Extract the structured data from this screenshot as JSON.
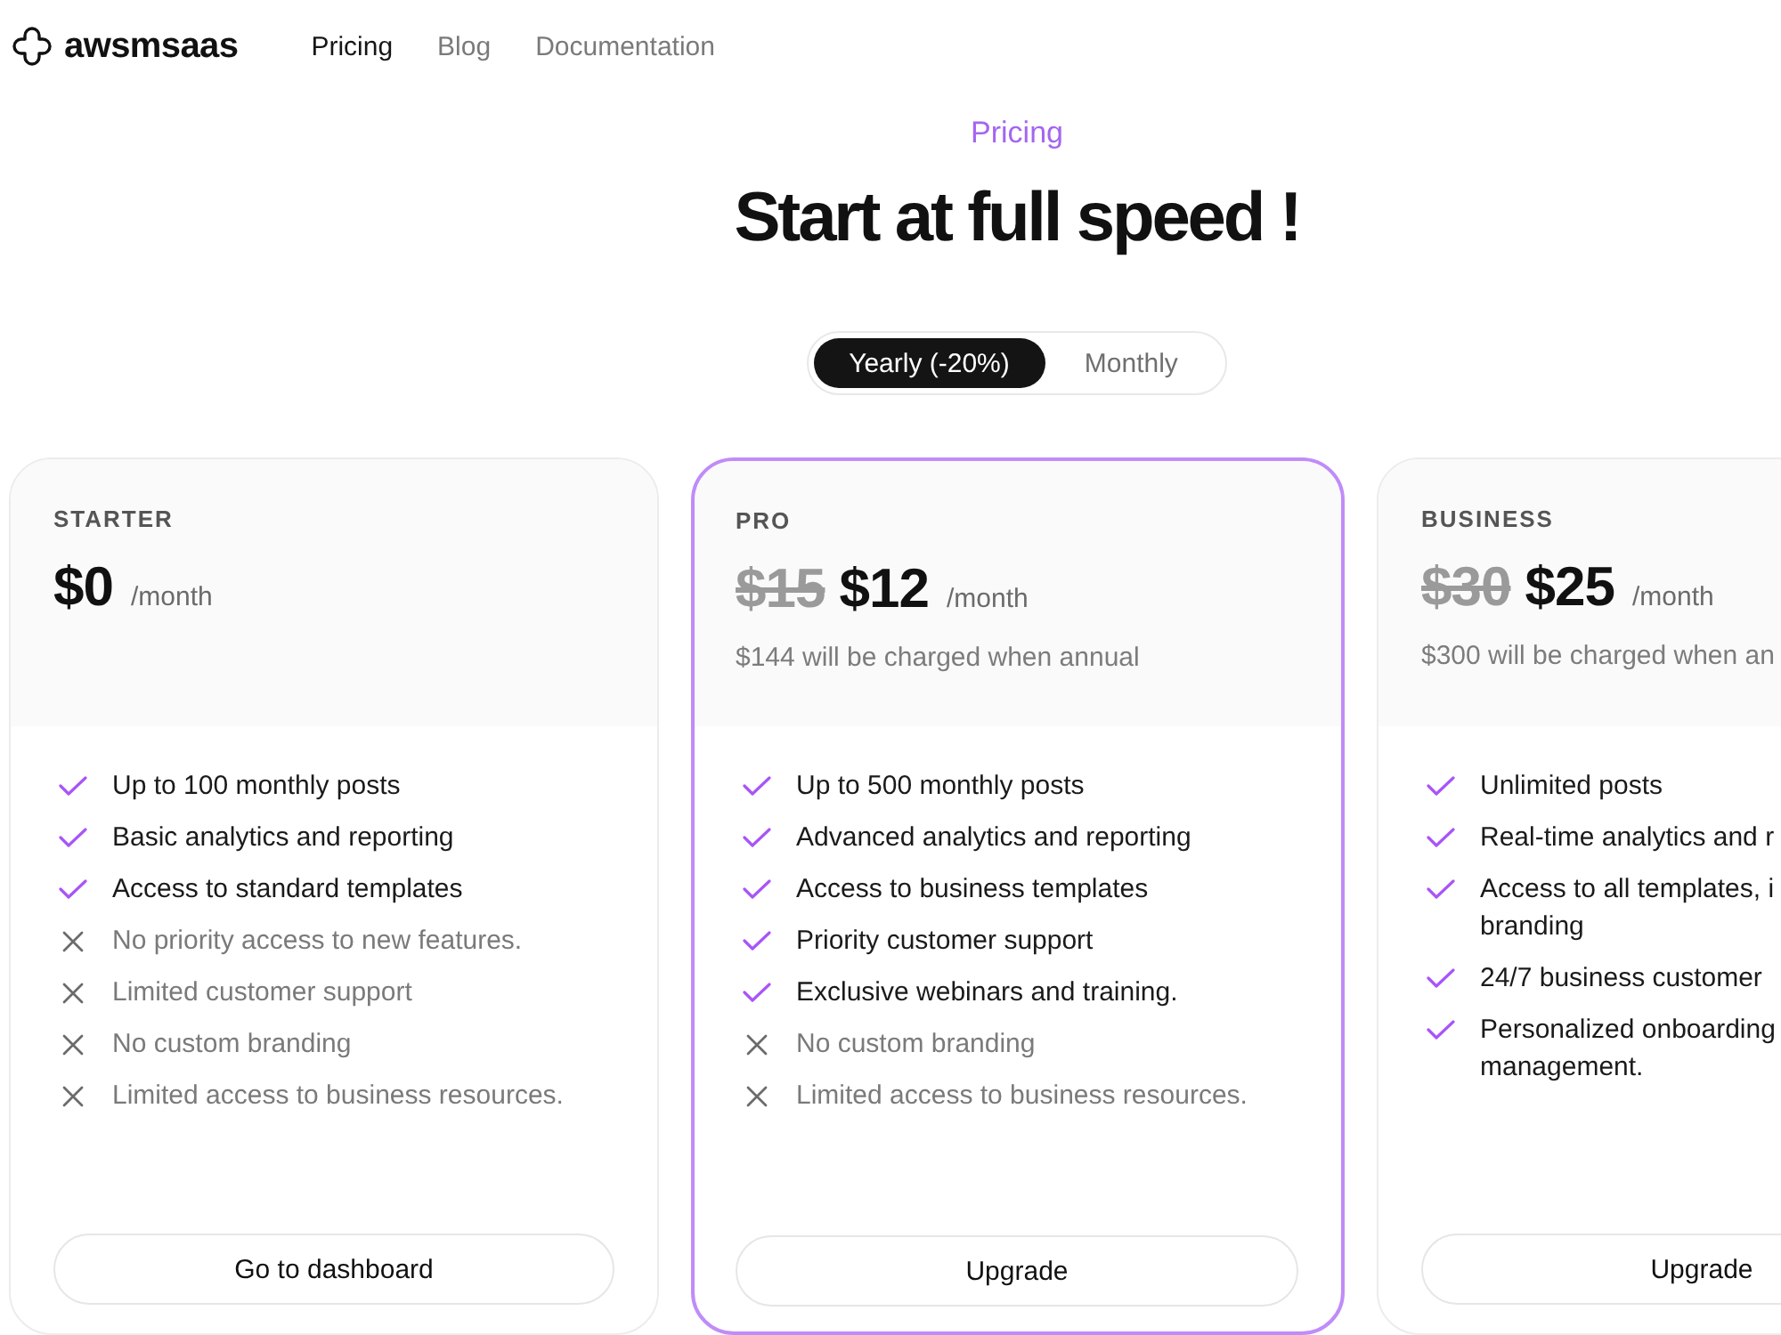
{
  "nav": {
    "logo": "awsmsaas",
    "links": [
      {
        "label": "Pricing",
        "selected": true
      },
      {
        "label": "Blog",
        "selected": false
      },
      {
        "label": "Documentation",
        "selected": false
      }
    ]
  },
  "hero": {
    "eyebrow": "Pricing",
    "title": "Start at full speed !"
  },
  "billing_toggle": [
    {
      "label": "Yearly (-20%)",
      "selected": true
    },
    {
      "label": "Monthly",
      "selected": false
    }
  ],
  "plans": [
    {
      "name": "STARTER",
      "highlighted": false,
      "price": "$0",
      "period": "/month",
      "features": [
        {
          "lines": [
            "Up to 100 monthly posts"
          ],
          "included": true
        },
        {
          "lines": [
            "Basic analytics and reporting"
          ],
          "included": true
        },
        {
          "lines": [
            "Access to standard templates"
          ],
          "included": true
        },
        {
          "lines": [
            "No priority access to new features."
          ],
          "included": false
        },
        {
          "lines": [
            "Limited customer support"
          ],
          "included": false
        },
        {
          "lines": [
            "No custom branding"
          ],
          "included": false
        },
        {
          "lines": [
            "Limited access to business resources."
          ],
          "included": false
        }
      ],
      "button": "Go to dashboard"
    },
    {
      "name": "PRO",
      "highlighted": true,
      "old_price": "$15",
      "price": "$12",
      "period": "/month",
      "note": "$144 will be charged when annual",
      "features": [
        {
          "lines": [
            "Up to 500 monthly posts"
          ],
          "included": true
        },
        {
          "lines": [
            "Advanced analytics and reporting"
          ],
          "included": true
        },
        {
          "lines": [
            "Access to business templates"
          ],
          "included": true
        },
        {
          "lines": [
            "Priority customer support"
          ],
          "included": true
        },
        {
          "lines": [
            "Exclusive webinars and training."
          ],
          "included": true
        },
        {
          "lines": [
            "No custom branding"
          ],
          "included": false
        },
        {
          "lines": [
            "Limited access to business resources."
          ],
          "included": false
        }
      ],
      "button": "Upgrade"
    },
    {
      "name": "BUSINESS",
      "highlighted": false,
      "old_price": "$30",
      "price": "$25",
      "period": "/month",
      "note": "$300 will be charged when an",
      "features": [
        {
          "lines": [
            "Unlimited posts"
          ],
          "included": true
        },
        {
          "lines": [
            "Real-time analytics and r"
          ],
          "included": true
        },
        {
          "lines": [
            "Access to all templates, i",
            "branding"
          ],
          "included": true
        },
        {
          "lines": [
            "24/7 business customer"
          ],
          "included": true
        },
        {
          "lines": [
            "Personalized onboarding",
            "management."
          ],
          "included": true
        }
      ],
      "button": "Upgrade"
    }
  ]
}
